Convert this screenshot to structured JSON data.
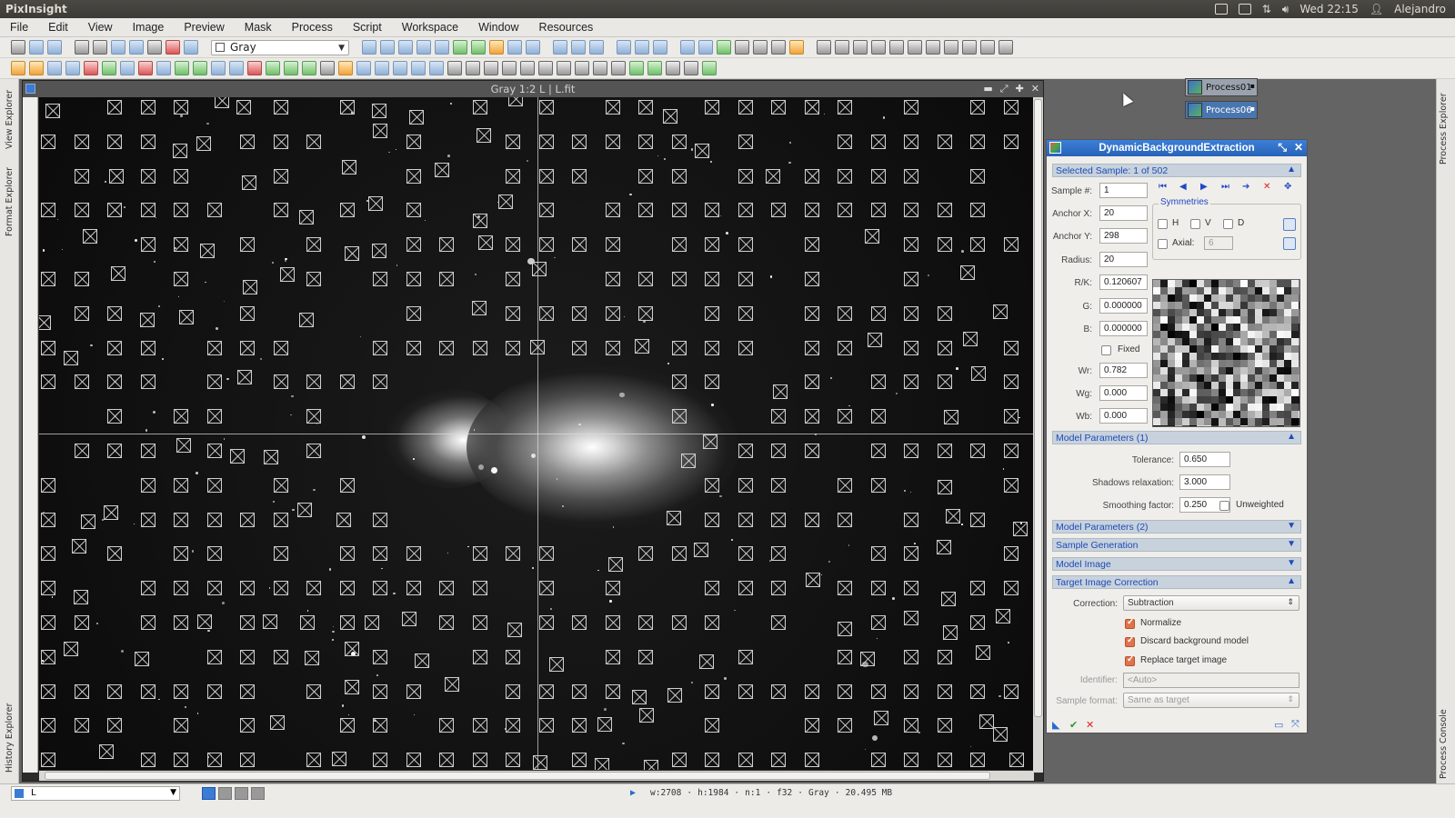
{
  "system_bar": {
    "app_name": "PixInsight",
    "clock": "Wed 22:15",
    "user": "Alejandro"
  },
  "menu": [
    "File",
    "Edit",
    "View",
    "Image",
    "Preview",
    "Mask",
    "Process",
    "Script",
    "Workspace",
    "Window",
    "Resources"
  ],
  "toolbar": {
    "color_space": "Gray"
  },
  "side_tabs": {
    "left": [
      "View Explorer",
      "Format Explorer",
      "History Explorer"
    ],
    "right": [
      "Process Explorer",
      "Process Console"
    ]
  },
  "image_window": {
    "title": "Gray 1:2 L | L.fit",
    "sample_count": 502
  },
  "process_icons": [
    "Process01",
    "Process06"
  ],
  "dbe": {
    "title": "DynamicBackgroundExtraction",
    "selected_sample_section": "Selected Sample: 1 of 502",
    "sample_num_label": "Sample #:",
    "sample_num": "1",
    "anchor_x_label": "Anchor X:",
    "anchor_x": "20",
    "anchor_y_label": "Anchor Y:",
    "anchor_y": "298",
    "radius_label": "Radius:",
    "radius": "20",
    "rk_label": "R/K:",
    "rk": "0.120607",
    "g_label": "G:",
    "g": "0.000000",
    "b_label": "B:",
    "b": "0.000000",
    "fixed_label": "Fixed",
    "wr_label": "Wr:",
    "wr": "0.782",
    "wg_label": "Wg:",
    "wg": "0.000",
    "wb_label": "Wb:",
    "wb": "0.000",
    "symmetries_label": "Symmetries",
    "sym_h": "H",
    "sym_v": "V",
    "sym_d": "D",
    "axial_label": "Axial:",
    "axial_value": "6",
    "model_params_1": "Model Parameters (1)",
    "tolerance_label": "Tolerance:",
    "tolerance": "0.650",
    "shadows_label": "Shadows relaxation:",
    "shadows": "3.000",
    "smoothing_label": "Smoothing factor:",
    "smoothing": "0.250",
    "unweighted_label": "Unweighted",
    "model_params_2": "Model Parameters (2)",
    "sample_generation": "Sample Generation",
    "model_image": "Model Image",
    "target_correction": "Target Image Correction",
    "correction_label": "Correction:",
    "correction": "Subtraction",
    "normalize_label": "Normalize",
    "discard_label": "Discard background model",
    "replace_label": "Replace target image",
    "identifier_label": "Identifier:",
    "identifier_placeholder": "<Auto>",
    "sample_format_label": "Sample format:",
    "sample_format": "Same as target"
  },
  "status_bar": {
    "view": "L",
    "width": "w:2708",
    "height": "h:1984",
    "channels": "n:1",
    "sample_type": "f32",
    "color": "Gray",
    "size": "20.495 MB"
  }
}
